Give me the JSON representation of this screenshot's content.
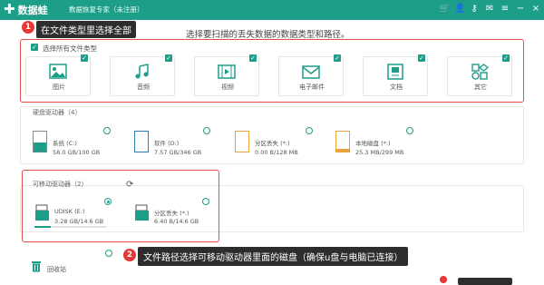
{
  "titlebar": {
    "logo": "数据蛙",
    "title": "数据恢复专家（未注册）",
    "icons": [
      "cart-icon",
      "user-icon",
      "key-icon",
      "feedback-icon",
      "menu-icon",
      "minimize-icon",
      "close-icon"
    ]
  },
  "annotations": {
    "step1_number": "1",
    "step1_text": "在文件类型里选择全部",
    "step2_number": "2",
    "step2_text": "文件路径选择可移动驱动器里面的磁盘（确保u盘与电脑已连接）"
  },
  "prompt": "选择要扫描的丢失数据的数据类型和路径。",
  "file_types": {
    "select_all_label": "选择所有文件类型",
    "items": [
      {
        "label": "图片",
        "icon": "image-icon",
        "checked": true
      },
      {
        "label": "音频",
        "icon": "audio-icon",
        "checked": true
      },
      {
        "label": "视频",
        "icon": "video-icon",
        "checked": true
      },
      {
        "label": "电子邮件",
        "icon": "email-icon",
        "checked": true
      },
      {
        "label": "文档",
        "icon": "document-icon",
        "checked": true
      },
      {
        "label": "其它",
        "icon": "other-icon",
        "checked": true
      }
    ]
  },
  "hard_drives": {
    "heading": "硬盘驱动器（4）",
    "items": [
      {
        "name": "系统 (C:)",
        "size": "58.0 GB/100 GB",
        "fill": 0.58,
        "selected": false
      },
      {
        "name": "软件 (D:)",
        "size": "7.57 GB/346 GB",
        "fill": 0.02,
        "selected": false
      },
      {
        "name": "分区丢失 (*:)",
        "size": "0.00 B/128 MB",
        "fill": 0.0,
        "selected": false
      },
      {
        "name": "本地磁盘 (*:)",
        "size": "25.3 MB/299 MB",
        "fill": 0.08,
        "selected": false
      }
    ]
  },
  "removable_drives": {
    "heading": "可移动驱动器（2）",
    "items": [
      {
        "name": "UDISK (E:)",
        "size": "3.28 GB/14.6 GB",
        "selected": true
      },
      {
        "name": "分区丢失 (*:)",
        "size": "6.40 B/14.6 GB",
        "selected": false
      }
    ]
  },
  "recycle_bin": {
    "label": "回收站",
    "selected": false
  },
  "colors": {
    "accent": "#1c9e88",
    "highlight": "#e0504a",
    "callout_bg": "#2d2d2d"
  }
}
